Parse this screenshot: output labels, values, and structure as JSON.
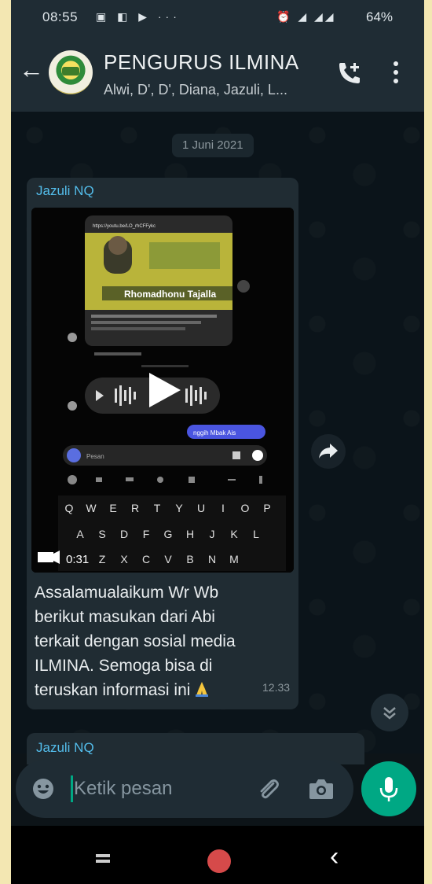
{
  "status_bar": {
    "time": "08:55",
    "battery": "64%"
  },
  "header": {
    "title": "PENGURUS ILMINA",
    "subtitle": "Alwi, D', D', Diana, Jazuli, L..."
  },
  "chat": {
    "date_chip": "1 Juni 2021",
    "message": {
      "sender": "Jazuli NQ",
      "video_duration": "0:31",
      "caption_lines": [
        "Assalamualaikum Wr Wb",
        "berikut masukan dari Abi",
        "terkait dengan sosial media",
        "ILMINA. Semoga bisa di",
        "teruskan informasi ini"
      ],
      "time": "12.33"
    },
    "next_message_sender": "Jazuli NQ"
  },
  "video_content": {
    "link_url": "https://youtu.be/LO_rhCFFykc",
    "banner": "Rhomadhonu Tajalla",
    "sent_bubble": "nggih Mbak Ais",
    "input_placeholder": "Pesan",
    "keyboard_rows": [
      [
        "Q",
        "W",
        "E",
        "R",
        "T",
        "Y",
        "U",
        "I",
        "O",
        "P"
      ],
      [
        "A",
        "S",
        "D",
        "F",
        "G",
        "H",
        "J",
        "K",
        "L"
      ],
      [
        "Z",
        "X",
        "C",
        "V",
        "B",
        "N",
        "M"
      ]
    ]
  },
  "composer": {
    "placeholder": "Ketik pesan"
  },
  "colors": {
    "header_bg": "#1f2c34",
    "chat_bg": "#0b141a",
    "bubble_bg": "#202c33",
    "accent": "#00a884",
    "sender_name": "#53bdeb"
  }
}
